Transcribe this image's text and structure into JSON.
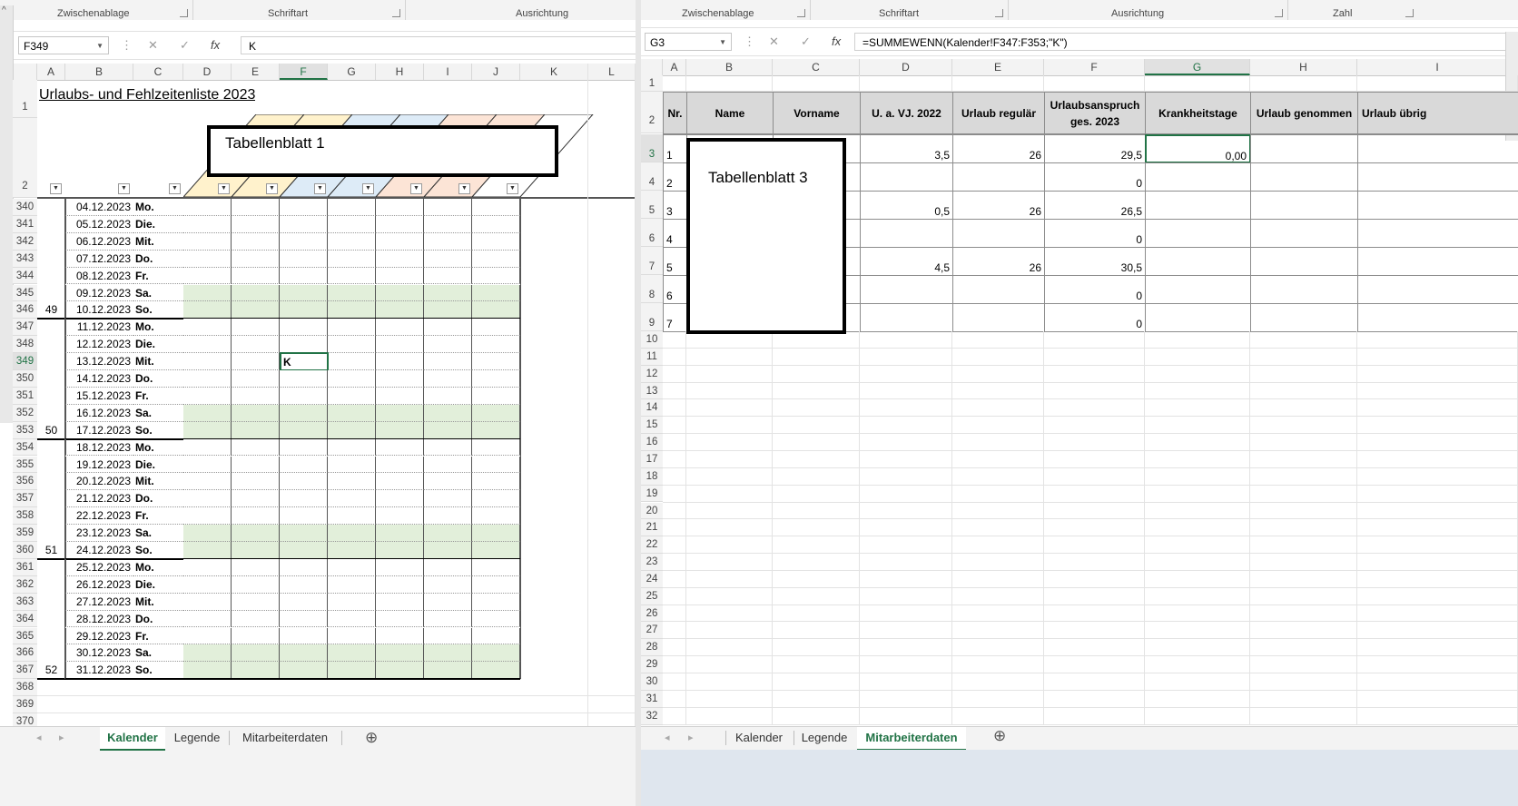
{
  "left": {
    "ribbon": [
      "Zwischenablage",
      "Schriftart",
      "Ausrichtung"
    ],
    "name_box": "F349",
    "formula_cancel": "✕",
    "formula_enter": "✓",
    "formula_fx": "fx",
    "formula": "K",
    "columns": [
      "A",
      "B",
      "C",
      "D",
      "E",
      "F",
      "G",
      "H",
      "I",
      "J",
      "K",
      "L"
    ],
    "title": "Urlaubs- und Fehlzeitenliste 2023",
    "header_row_numbers": [
      "1",
      "2"
    ],
    "callout": "Tabellenblatt 1",
    "rows": [
      {
        "n": "340",
        "week": "",
        "date": "04.12.2023",
        "day": "Mo."
      },
      {
        "n": "341",
        "week": "",
        "date": "05.12.2023",
        "day": "Die."
      },
      {
        "n": "342",
        "week": "",
        "date": "06.12.2023",
        "day": "Mit."
      },
      {
        "n": "343",
        "week": "",
        "date": "07.12.2023",
        "day": "Do."
      },
      {
        "n": "344",
        "week": "",
        "date": "08.12.2023",
        "day": "Fr."
      },
      {
        "n": "345",
        "week": "",
        "date": "09.12.2023",
        "day": "Sa."
      },
      {
        "n": "346",
        "week": "49",
        "date": "10.12.2023",
        "day": "So."
      },
      {
        "n": "347",
        "week": "",
        "date": "11.12.2023",
        "day": "Mo."
      },
      {
        "n": "348",
        "week": "",
        "date": "12.12.2023",
        "day": "Die."
      },
      {
        "n": "349",
        "week": "",
        "date": "13.12.2023",
        "day": "Mit."
      },
      {
        "n": "350",
        "week": "",
        "date": "14.12.2023",
        "day": "Do."
      },
      {
        "n": "351",
        "week": "",
        "date": "15.12.2023",
        "day": "Fr."
      },
      {
        "n": "352",
        "week": "",
        "date": "16.12.2023",
        "day": "Sa."
      },
      {
        "n": "353",
        "week": "50",
        "date": "17.12.2023",
        "day": "So."
      },
      {
        "n": "354",
        "week": "",
        "date": "18.12.2023",
        "day": "Mo."
      },
      {
        "n": "355",
        "week": "",
        "date": "19.12.2023",
        "day": "Die."
      },
      {
        "n": "356",
        "week": "",
        "date": "20.12.2023",
        "day": "Mit."
      },
      {
        "n": "357",
        "week": "",
        "date": "21.12.2023",
        "day": "Do."
      },
      {
        "n": "358",
        "week": "",
        "date": "22.12.2023",
        "day": "Fr."
      },
      {
        "n": "359",
        "week": "",
        "date": "23.12.2023",
        "day": "Sa."
      },
      {
        "n": "360",
        "week": "51",
        "date": "24.12.2023",
        "day": "So."
      },
      {
        "n": "361",
        "week": "",
        "date": "25.12.2023",
        "day": "Mo."
      },
      {
        "n": "362",
        "week": "",
        "date": "26.12.2023",
        "day": "Die."
      },
      {
        "n": "363",
        "week": "",
        "date": "27.12.2023",
        "day": "Mit."
      },
      {
        "n": "364",
        "week": "",
        "date": "28.12.2023",
        "day": "Do."
      },
      {
        "n": "365",
        "week": "",
        "date": "29.12.2023",
        "day": "Fr."
      },
      {
        "n": "366",
        "week": "",
        "date": "30.12.2023",
        "day": "Sa."
      },
      {
        "n": "367",
        "week": "52",
        "date": "31.12.2023",
        "day": "So."
      },
      {
        "n": "368",
        "week": "",
        "date": "",
        "day": ""
      },
      {
        "n": "369",
        "week": "",
        "date": "",
        "day": ""
      },
      {
        "n": "370",
        "week": "",
        "date": "",
        "day": ""
      }
    ],
    "active_cell_value": "K",
    "tabs": [
      "Kalender",
      "Legende",
      "Mitarbeiterdaten"
    ],
    "add_sheet": "⊕",
    "nav_prev": "◂",
    "nav_next": "▸"
  },
  "right": {
    "ribbon": [
      "Zwischenablage",
      "Schriftart",
      "Ausrichtung",
      "Zahl"
    ],
    "name_box": "G3",
    "formula_cancel": "✕",
    "formula_enter": "✓",
    "formula_fx": "fx",
    "formula": "=SUMMEWENN(Kalender!F347:F353;\"K\")",
    "columns": [
      "A",
      "B",
      "C",
      "D",
      "E",
      "F",
      "G",
      "H",
      "I"
    ],
    "headers": [
      "Nr.",
      "Name",
      "Vorname",
      "U. a. VJ. 2022",
      "Urlaub regulär",
      "Urlaubsanspruch ges. 2023",
      "Krankheitstage",
      "Urlaub genommen",
      "Urlaub übrig"
    ],
    "header_row_numbers": [
      "1",
      "2"
    ],
    "callout": "Tabellenblatt 3",
    "data_rows": [
      {
        "n": "3",
        "nr": "1",
        "vj": "3,5",
        "reg": "26",
        "ges": "29,5",
        "krank": "0,00"
      },
      {
        "n": "4",
        "nr": "2",
        "vj": "",
        "reg": "",
        "ges": "0",
        "krank": ""
      },
      {
        "n": "5",
        "nr": "3",
        "vj": "0,5",
        "reg": "26",
        "ges": "26,5",
        "krank": ""
      },
      {
        "n": "6",
        "nr": "4",
        "vj": "",
        "reg": "",
        "ges": "0",
        "krank": ""
      },
      {
        "n": "7",
        "nr": "5",
        "vj": "4,5",
        "reg": "26",
        "ges": "30,5",
        "krank": ""
      },
      {
        "n": "8",
        "nr": "6",
        "vj": "",
        "reg": "",
        "ges": "0",
        "krank": ""
      },
      {
        "n": "9",
        "nr": "7",
        "vj": "",
        "reg": "",
        "ges": "0",
        "krank": ""
      }
    ],
    "empty_rows": [
      "10",
      "11",
      "12",
      "13",
      "14",
      "15",
      "16",
      "17",
      "18",
      "19",
      "20",
      "21",
      "22",
      "23",
      "24",
      "25",
      "26",
      "27",
      "28",
      "29",
      "30",
      "31",
      "32"
    ],
    "tabs": [
      "Kalender",
      "Legende",
      "Mitarbeiterdaten"
    ],
    "add_sheet": "⊕",
    "nav_prev": "◂",
    "nav_next": "▸"
  },
  "colors": {
    "accent_green": "#217346",
    "weekend_fill": "#e2efda",
    "header_gray": "#d9d9d9",
    "stripe_yellow": "#fff2cc",
    "stripe_blue": "#ddebf7",
    "stripe_peach": "#fce4d6"
  }
}
